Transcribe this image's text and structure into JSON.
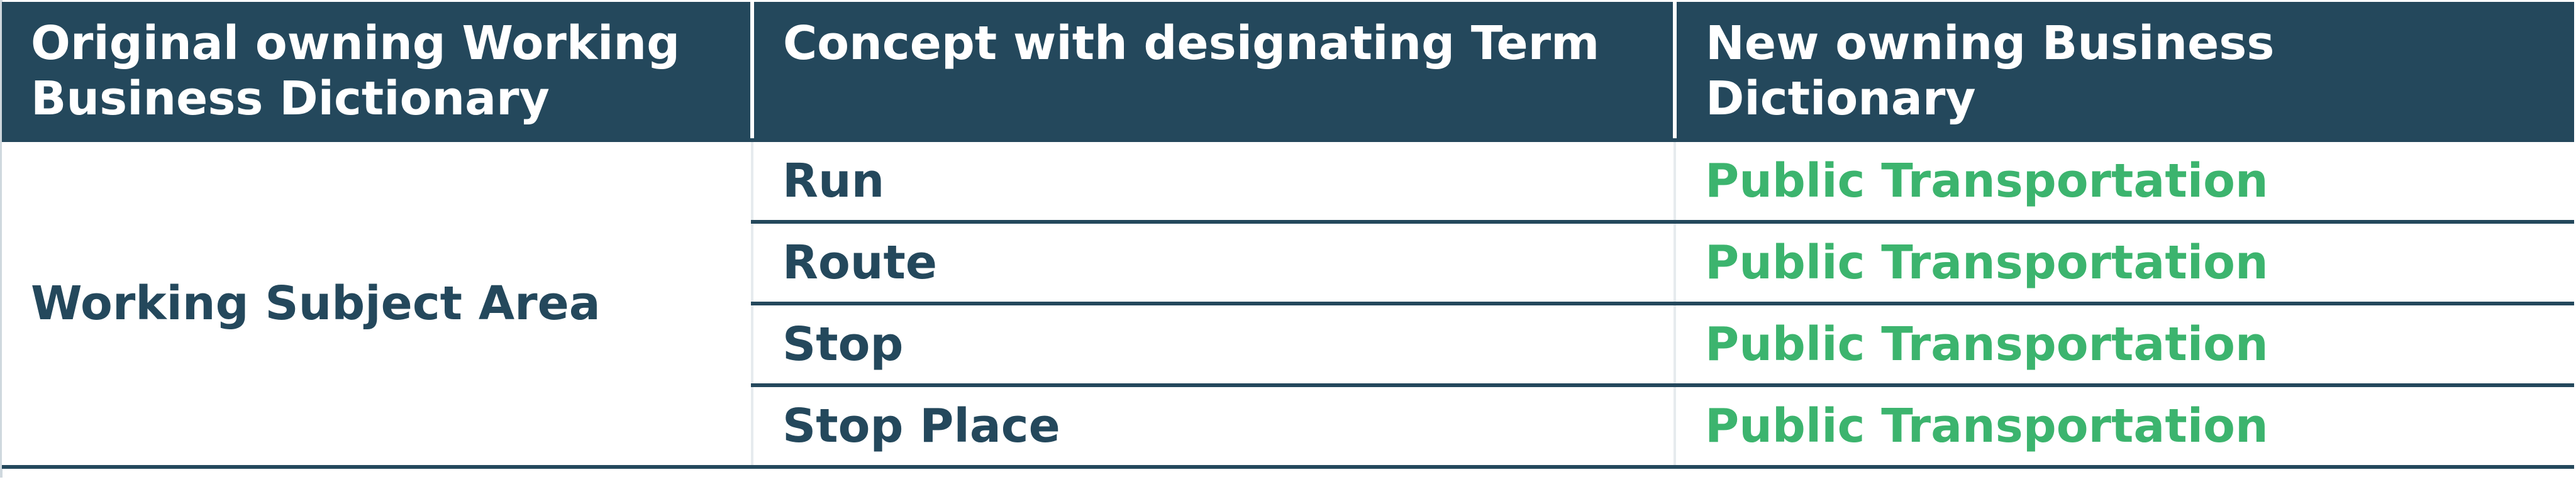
{
  "table": {
    "headers": [
      "Original owning Working Business Dictionary",
      "Concept with designating Term",
      "New owning Business Dictionary"
    ],
    "group_label": "Working Subject Area",
    "rows": [
      {
        "concept": "Run",
        "dictionary": "Public Transportation"
      },
      {
        "concept": "Route",
        "dictionary": "Public Transportation"
      },
      {
        "concept": "Stop",
        "dictionary": "Public Transportation"
      },
      {
        "concept": "Stop Place",
        "dictionary": "Public Transportation"
      }
    ]
  },
  "colors": {
    "header_bg": "#24485c",
    "header_text": "#ffffff",
    "body_text": "#24485c",
    "dictionary_text": "#3cb46e"
  }
}
